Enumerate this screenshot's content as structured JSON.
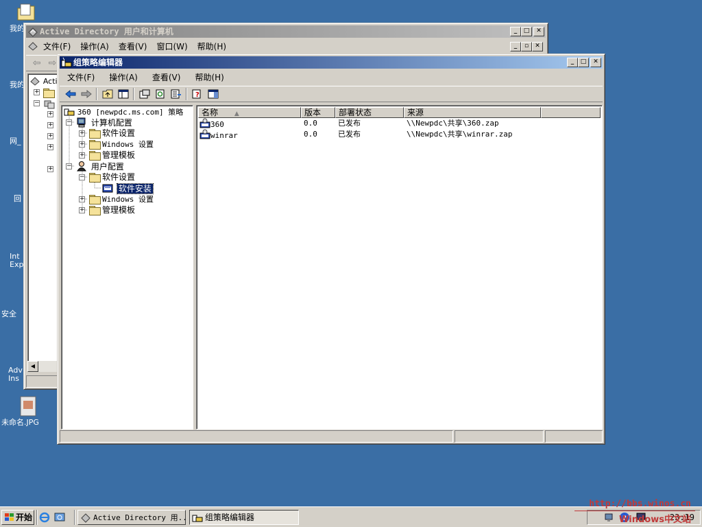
{
  "desktop": {
    "icons": [
      {
        "label": "我的"
      },
      {
        "label": "我的"
      },
      {
        "label": "网_"
      },
      {
        "label": "回"
      },
      {
        "label": "Int Exp"
      },
      {
        "label": "安全"
      },
      {
        "label": "Adv Ins"
      },
      {
        "label": "未命名.JPG"
      }
    ]
  },
  "ad_window": {
    "title": "Active Directory 用户和计算机",
    "menus": [
      "文件(F)",
      "操作(A)",
      "查看(V)",
      "窗口(W)",
      "帮助(H)"
    ],
    "tree_root": "Acti"
  },
  "gpe_window": {
    "title": "组策略编辑器",
    "menus": [
      "文件(F)",
      "操作(A)",
      "查看(V)",
      "帮助(H)"
    ],
    "tree": {
      "root": "360 [newpdc.ms.com] 策略",
      "computer_config": "计算机配置",
      "user_config": "用户配置",
      "software_settings": "软件设置",
      "windows_settings": "Windows 设置",
      "admin_templates": "管理模板",
      "software_install": "软件安装"
    },
    "list": {
      "columns": [
        "名称",
        "版本",
        "部署状态",
        "来源"
      ],
      "rows": [
        {
          "name": "360",
          "version": "0.0",
          "state": "已发布",
          "source": "\\\\Newpdc\\共享\\360.zap"
        },
        {
          "name": "winrar",
          "version": "0.0",
          "state": "已发布",
          "source": "\\\\Newpdc\\共享\\winrar.zap"
        }
      ]
    }
  },
  "taskbar": {
    "start_label": "开始",
    "tasks": [
      "Active Directory 用...",
      "组策略编辑器"
    ],
    "clock": "23:19"
  },
  "watermark": {
    "url": "http://bbs.winos.cn",
    "text": "Windows中文站"
  },
  "colors": {
    "desktop": "#3a6ea5",
    "title_active": "#0a246a",
    "face": "#d4d0c8"
  }
}
